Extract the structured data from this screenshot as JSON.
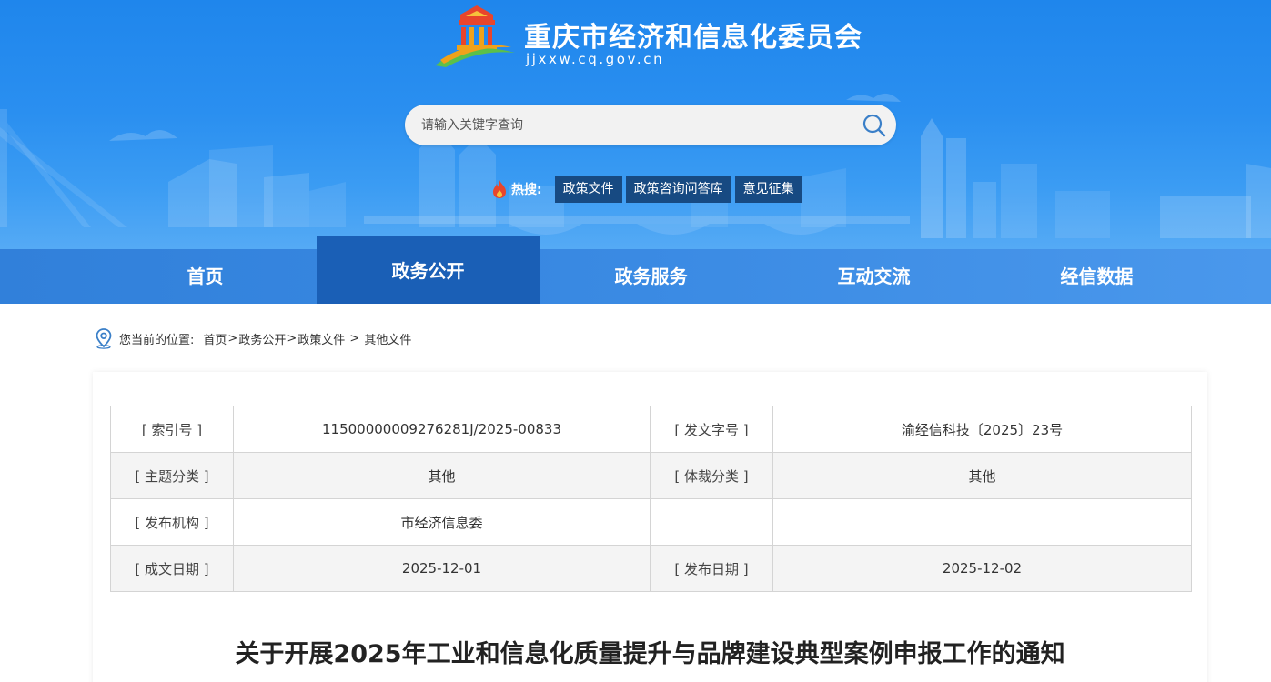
{
  "header": {
    "site_title": "重庆市经济和信息化委员会",
    "site_domain": "jjxxw.cq.gov.cn",
    "search_placeholder": "请输入关键字查询",
    "hot_label": "热搜:",
    "hot_tags": [
      "政策文件",
      "政策咨询问答库",
      "意见征集"
    ]
  },
  "nav": {
    "items": [
      "首页",
      "政务公开",
      "政务服务",
      "互动交流",
      "经信数据"
    ],
    "active_index": 1
  },
  "breadcrumb": {
    "prefix": "您当前的位置:",
    "items": [
      "首页",
      "政务公开",
      "政策文件",
      "其他文件"
    ]
  },
  "info_table": {
    "rows": [
      [
        "[ 索引号 ]",
        "11500000009276281J/2025-00833",
        "[ 发文字号 ]",
        "渝经信科技〔2025〕23号"
      ],
      [
        "[ 主题分类 ]",
        "其他",
        "[ 体裁分类 ]",
        "其他"
      ],
      [
        "[ 发布机构 ]",
        "市经济信息委",
        "",
        ""
      ],
      [
        "[ 成文日期 ]",
        "2025-12-01",
        "[ 发布日期 ]",
        "2025-12-02"
      ]
    ]
  },
  "document": {
    "title": "关于开展2025年工业和信息化质量提升与品牌建设典型案例申报工作的通知"
  },
  "colors": {
    "header_blue": "#2a8ff0",
    "nav_active": "#1a5fb6",
    "hot_tag_bg": "#174a82"
  }
}
